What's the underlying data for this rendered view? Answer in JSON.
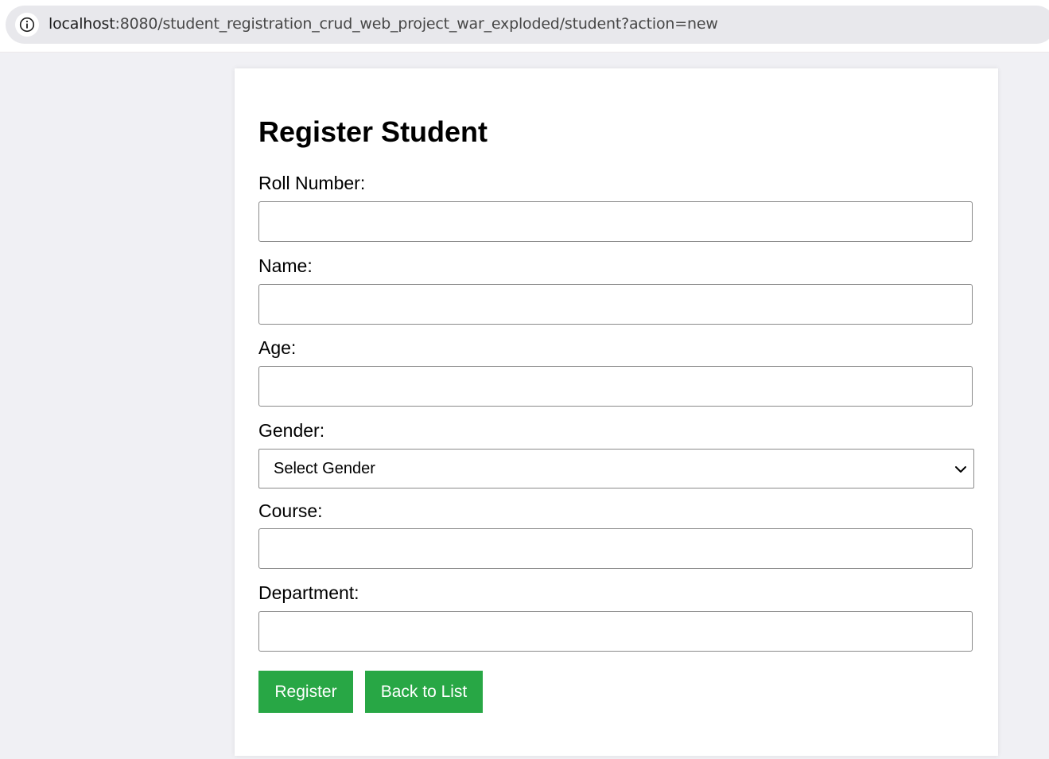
{
  "browser": {
    "url_host": "localhost",
    "url_rest": ":8080/student_registration_crud_web_project_war_exploded/student?action=new"
  },
  "form": {
    "title": "Register Student",
    "fields": [
      {
        "label": "Roll Number:",
        "value": ""
      },
      {
        "label": "Name:",
        "value": ""
      },
      {
        "label": "Age:",
        "value": ""
      },
      {
        "label": "Gender:",
        "selected": "Select Gender"
      },
      {
        "label": "Course:",
        "value": ""
      },
      {
        "label": "Department:",
        "value": ""
      }
    ],
    "register_label": "Register",
    "back_label": "Back to List"
  },
  "colors": {
    "button": "#28a745",
    "page_bg": "#f0f0f4",
    "card_bg": "#ffffff"
  }
}
